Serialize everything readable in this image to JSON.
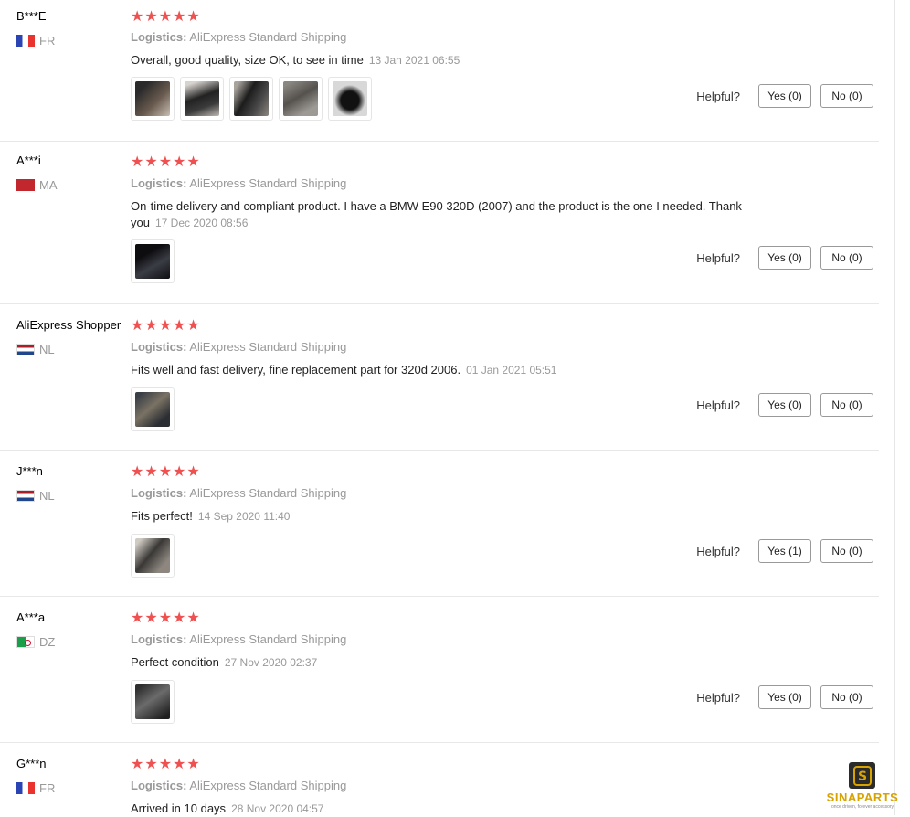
{
  "helpful_label": "Helpful?",
  "colors": {
    "star": "#f05050",
    "muted": "#999999",
    "border": "#e8e8e8"
  },
  "reviews": [
    {
      "user": "B***E",
      "country": "FR",
      "rating": 5,
      "stars": "★★★★★",
      "logistics_label": "Logistics:",
      "logistics_value": "AliExpress Standard Shipping",
      "feedback": "Overall, good quality, size OK, to see in time",
      "date": "13 Jan 2021 06:55",
      "photo_count": 5,
      "yes": "Yes (0)",
      "no": "No (0)"
    },
    {
      "user": "A***i",
      "country": "MA",
      "rating": 5,
      "stars": "★★★★★",
      "logistics_label": "Logistics:",
      "logistics_value": "AliExpress Standard Shipping",
      "feedback": "On-time delivery and compliant product. I have a BMW E90 320D (2007) and the product is the one I needed. Thank you",
      "date": "17 Dec 2020 08:56",
      "photo_count": 1,
      "yes": "Yes (0)",
      "no": "No (0)"
    },
    {
      "user": "AliExpress Shopper",
      "country": "NL",
      "rating": 5,
      "stars": "★★★★★",
      "logistics_label": "Logistics:",
      "logistics_value": "AliExpress Standard Shipping",
      "feedback": "Fits well and fast delivery, fine replacement part for 320d 2006.",
      "date": "01 Jan 2021 05:51",
      "photo_count": 1,
      "yes": "Yes (0)",
      "no": "No (0)"
    },
    {
      "user": "J***n",
      "country": "NL",
      "rating": 5,
      "stars": "★★★★★",
      "logistics_label": "Logistics:",
      "logistics_value": "AliExpress Standard Shipping",
      "feedback": "Fits perfect!",
      "date": "14 Sep 2020 11:40",
      "photo_count": 1,
      "yes": "Yes (1)",
      "no": "No (0)"
    },
    {
      "user": "A***a",
      "country": "DZ",
      "rating": 5,
      "stars": "★★★★★",
      "logistics_label": "Logistics:",
      "logistics_value": "AliExpress Standard Shipping",
      "feedback": "Perfect condition",
      "date": "27 Nov 2020 02:37",
      "photo_count": 1,
      "yes": "Yes (0)",
      "no": "No (0)"
    },
    {
      "user": "G***n",
      "country": "FR",
      "rating": 5,
      "stars": "★★★★★",
      "logistics_label": "Logistics:",
      "logistics_value": "AliExpress Standard Shipping",
      "feedback": "Arrived in 10 days",
      "date": "28 Nov 2020 04:57",
      "photo_count": 0
    }
  ],
  "watermark": {
    "brand": "SINAPARTS",
    "tagline": "once driven, forever accessory",
    "icon": "s-logo-icon"
  }
}
